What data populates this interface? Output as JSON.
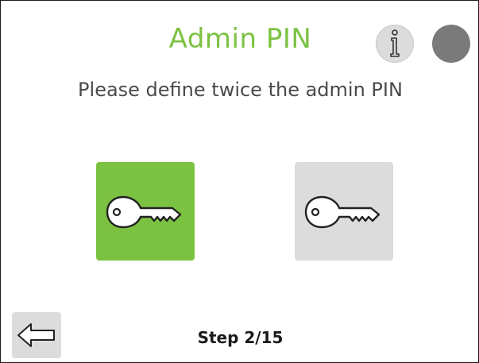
{
  "header": {
    "title": "Admin PIN",
    "info_icon": "info-icon",
    "status_indicator_color": "#7a7a7a"
  },
  "instructions": "Please define twice the admin PIN",
  "pin_entries": [
    {
      "icon": "key-icon",
      "state": "active",
      "color": "#7cc242"
    },
    {
      "icon": "key-icon",
      "state": "inactive",
      "color": "#dcdcdc"
    }
  ],
  "footer": {
    "back_icon": "back-arrow-icon",
    "step_label": "Step 2/15"
  },
  "colors": {
    "accent": "#7cc242",
    "button_gray": "#dcdcdc",
    "text": "#4a4a4a"
  }
}
